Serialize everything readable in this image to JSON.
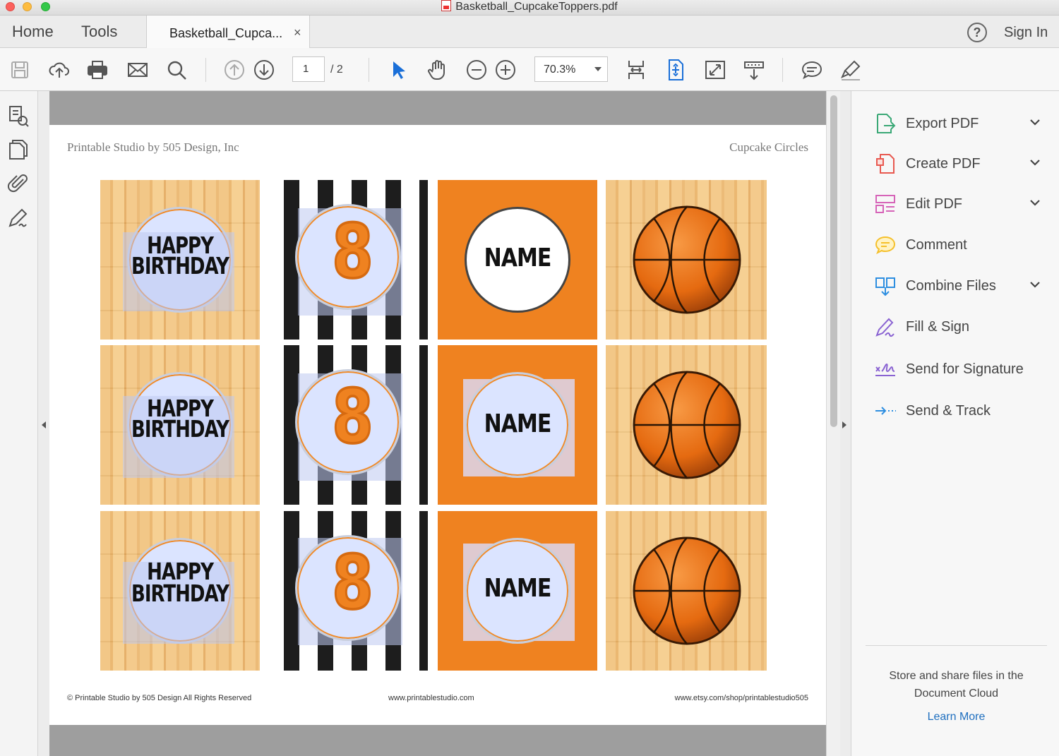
{
  "window": {
    "title": "Basketball_CupcakeToppers.pdf"
  },
  "tabs": {
    "home": "Home",
    "tools": "Tools",
    "document_tab": "Basketball_Cupca...",
    "close": "×",
    "help": "?",
    "sign_in": "Sign In"
  },
  "toolbar": {
    "page_current": "1",
    "page_total": "/ 2",
    "zoom": "70.3%",
    "icons": [
      "save-icon",
      "upload-icon",
      "print-icon",
      "email-icon",
      "search-icon",
      "page-up-icon",
      "page-down-icon",
      "select-cursor-icon",
      "hand-icon",
      "zoom-out-icon",
      "zoom-in-icon",
      "scroll-mode-icon",
      "fit-page-icon",
      "full-screen-icon",
      "read-mode-icon",
      "comment-icon",
      "highlight-icon"
    ]
  },
  "left_rail": {
    "icons": [
      "pages-icon",
      "copy-pages-icon",
      "attachment-icon",
      "signature-icon"
    ]
  },
  "document": {
    "header_left": "Printable Studio by 505 Design, Inc",
    "header_right": "Cupcake Circles",
    "footer_left": "© Printable Studio by 505 Design All Rights Reserved",
    "footer_center": "www.printablestudio.com",
    "footer_right": "www.etsy.com/shop/printablestudio505",
    "toppers": {
      "happy": "HAPPY",
      "birthday": "BIRTHDAY",
      "number": "8",
      "name": "NAME"
    },
    "colors": {
      "orange": "#ef8220",
      "wood": "#f1c27d",
      "stripe": "#1d1d1d",
      "selection": "#bec8f0"
    }
  },
  "right_panel": {
    "items": [
      {
        "label": "Export PDF",
        "icon": "export-pdf-icon",
        "color": "#3aa876",
        "dropdown": true
      },
      {
        "label": "Create PDF",
        "icon": "create-pdf-icon",
        "color": "#e8584f",
        "dropdown": true
      },
      {
        "label": "Edit PDF",
        "icon": "edit-pdf-icon",
        "color": "#d664b8",
        "dropdown": true
      },
      {
        "label": "Comment",
        "icon": "comment-icon",
        "color": "#f5c02b",
        "dropdown": false
      },
      {
        "label": "Combine Files",
        "icon": "combine-files-icon",
        "color": "#2d8ee0",
        "dropdown": true
      },
      {
        "label": "Fill & Sign",
        "icon": "fill-sign-icon",
        "color": "#8a63d2",
        "dropdown": false
      },
      {
        "label": "Send for Signature",
        "icon": "send-signature-icon",
        "color": "#8a63d2",
        "dropdown": false
      },
      {
        "label": "Send & Track",
        "icon": "send-track-icon",
        "color": "#2d8ee0",
        "dropdown": false
      }
    ],
    "promo": "Store and share files in the Document Cloud",
    "learn_more": "Learn More"
  }
}
